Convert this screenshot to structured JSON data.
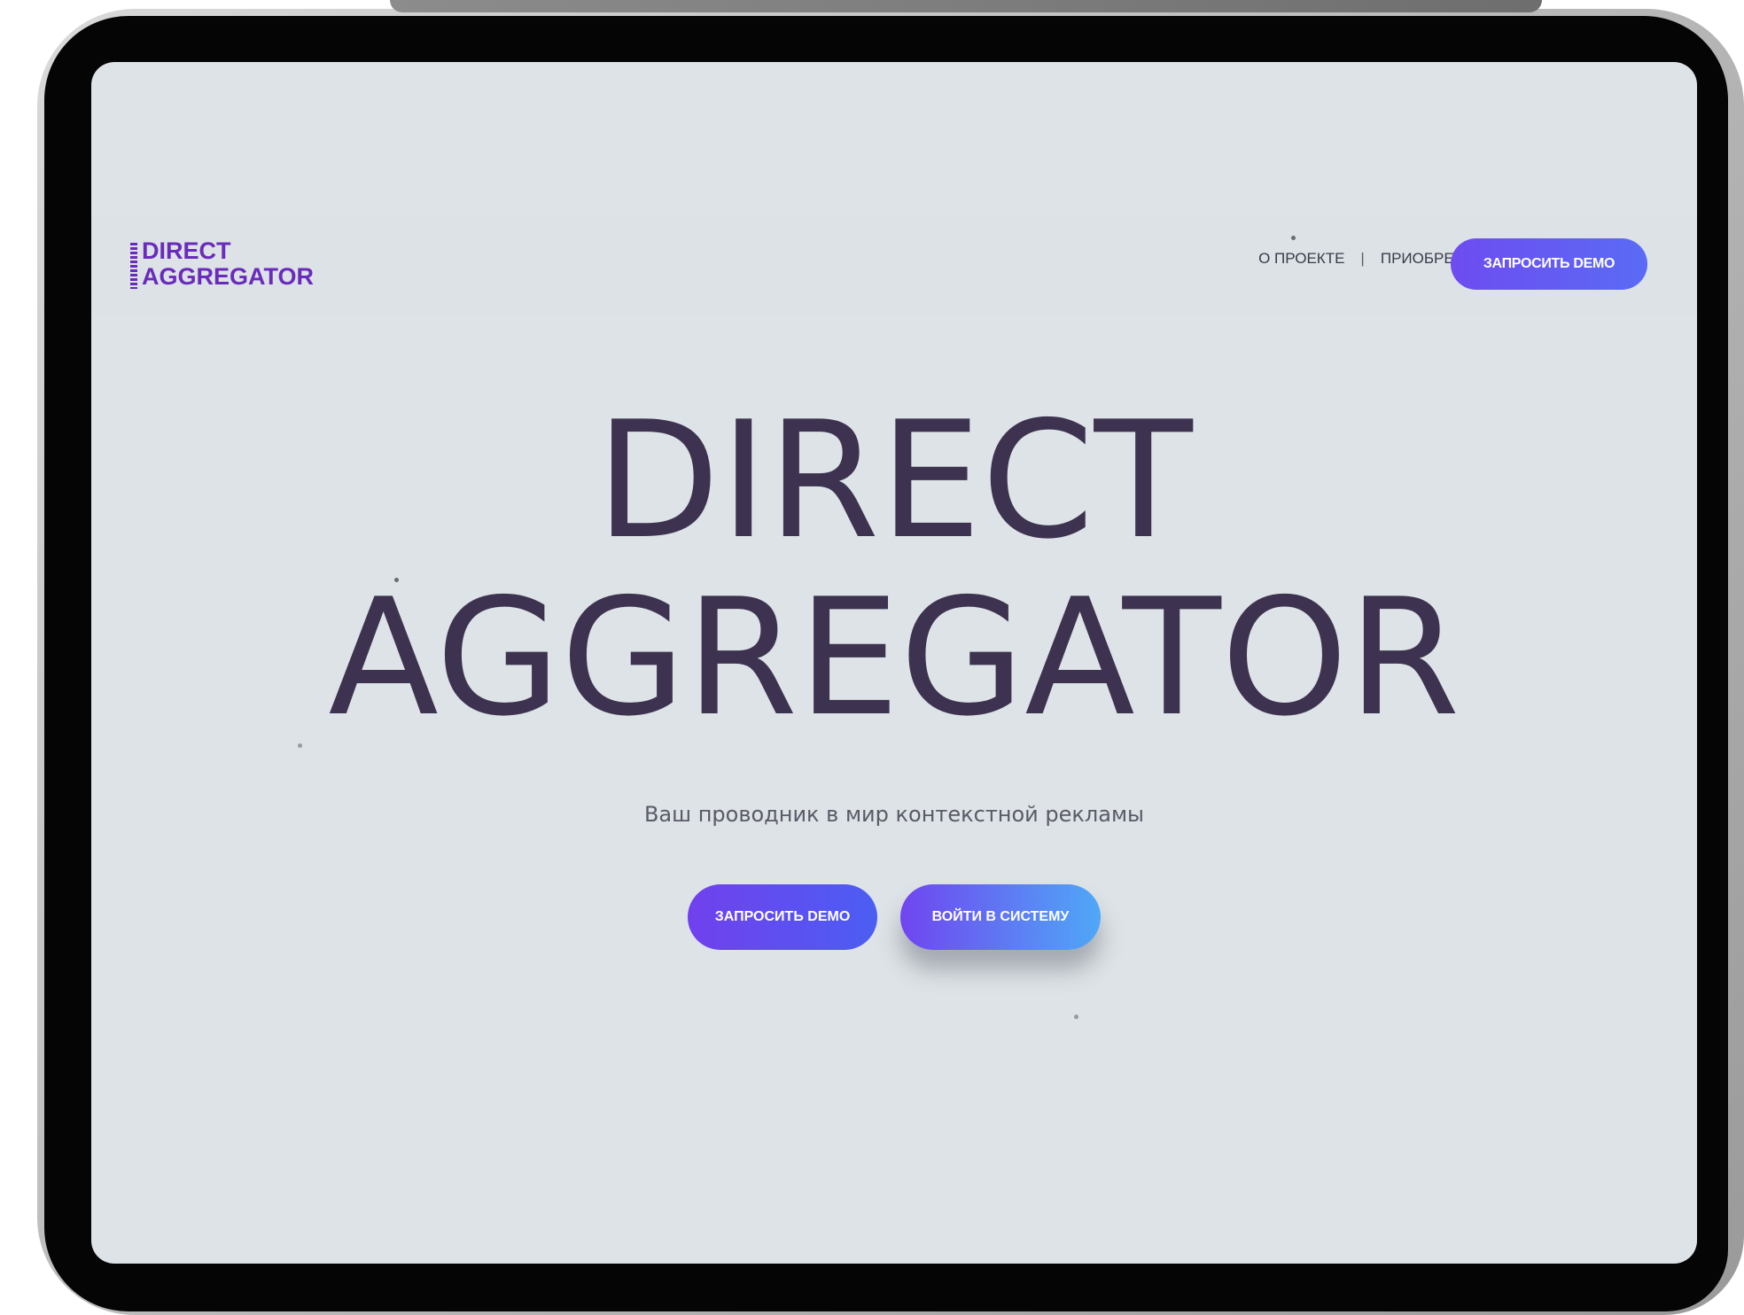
{
  "logo": {
    "line1": "DIRECT",
    "line2": "AGGREGATOR",
    "color": "#6a2bbd"
  },
  "nav": {
    "about": "О ПРОЕКТЕ",
    "separator": "|",
    "buy": "ПРИОБРЕСТИ",
    "demo_button": "ЗАПРОСИТЬ DEMO"
  },
  "hero": {
    "title_line1": "DIRECT",
    "title_line2": "AGGREGATOR",
    "subtitle": "Ваш проводник в мир контекстной рекламы",
    "demo_button": "ЗАПРОСИТЬ DEMO",
    "login_button": "ВОЙТИ В СИСТЕМУ"
  },
  "colors": {
    "background": "#dde3e6",
    "title": "#3d3350",
    "accent_gradient_start": "#7140ee",
    "accent_gradient_end": "#4fa8f7"
  }
}
